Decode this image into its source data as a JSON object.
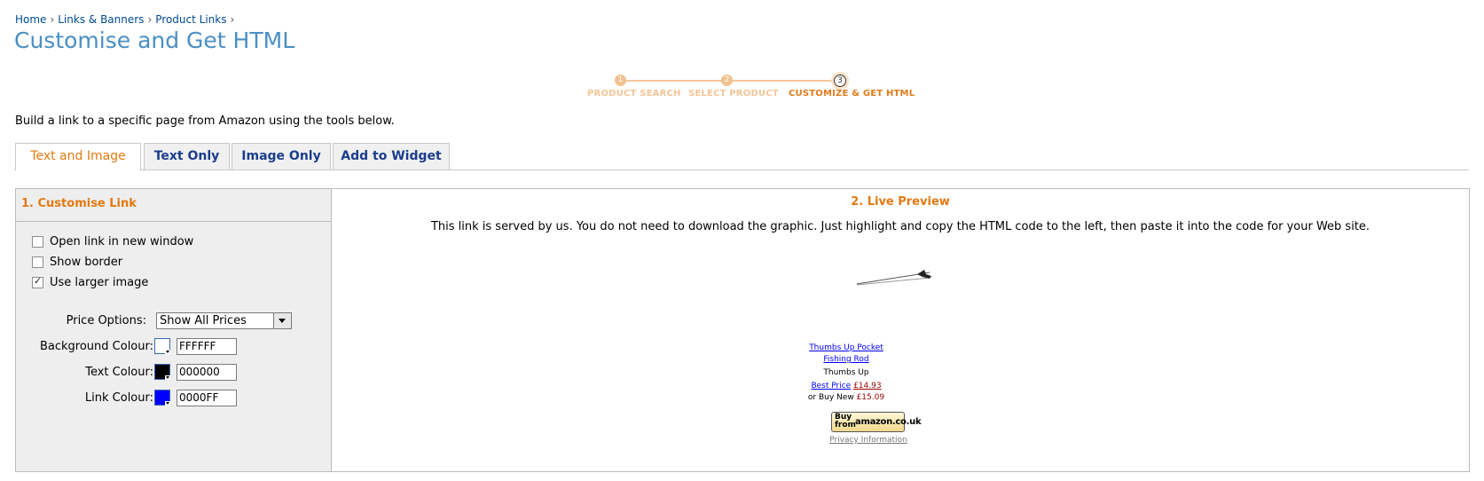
{
  "breadcrumb": {
    "items": [
      "Home",
      "Links & Banners",
      "Product Links"
    ],
    "separator": "›"
  },
  "page_title": "Customise and Get HTML",
  "steps": [
    {
      "number": "1",
      "label": "PRODUCT SEARCH"
    },
    {
      "number": "2",
      "label": "SELECT PRODUCT"
    },
    {
      "number": "3",
      "label": "CUSTOMIZE & GET HTML",
      "current": true
    }
  ],
  "intro": "Build a link to a specific page from Amazon using the tools below.",
  "tabs": [
    "Text and Image",
    "Text Only",
    "Image Only",
    "Add to Widget"
  ],
  "customise": {
    "heading": "1. Customise Link",
    "checkboxes": [
      {
        "label": "Open link in new window",
        "checked": false
      },
      {
        "label": "Show border",
        "checked": false
      },
      {
        "label": "Use larger image",
        "checked": true
      }
    ],
    "price_options_label": "Price Options:",
    "price_options_value": "Show All Prices",
    "background": {
      "label": "Background Colour:",
      "value": "FFFFFF",
      "color": "#FFFFFF"
    },
    "text_colour": {
      "label": "Text Colour:",
      "value": "000000",
      "color": "#000000"
    },
    "link_colour": {
      "label": "Link Colour:",
      "value": "0000FF",
      "color": "#0000FF"
    }
  },
  "preview": {
    "heading": "2. Live Preview",
    "description": "This link is served by us. You do not need to download the graphic. Just highlight and copy the HTML code to the left, then paste it into the code for your Web site.",
    "product_title_line1": "Thumbs Up Pocket",
    "product_title_line2": "Fishing Rod",
    "brand": "Thumbs Up",
    "best_price_label": "Best Price",
    "best_price": "£14.93",
    "buy_new_text": "or Buy New",
    "buy_new_price": "£15.09",
    "buy_button_line1": "Buy",
    "buy_button_line2": "from",
    "buy_button_brand": "amazon.co.uk",
    "privacy": "Privacy Information"
  },
  "colors": {
    "accent_orange": "#e47911",
    "title_blue": "#4a8fc3",
    "step_inactive": "#f4c596"
  }
}
